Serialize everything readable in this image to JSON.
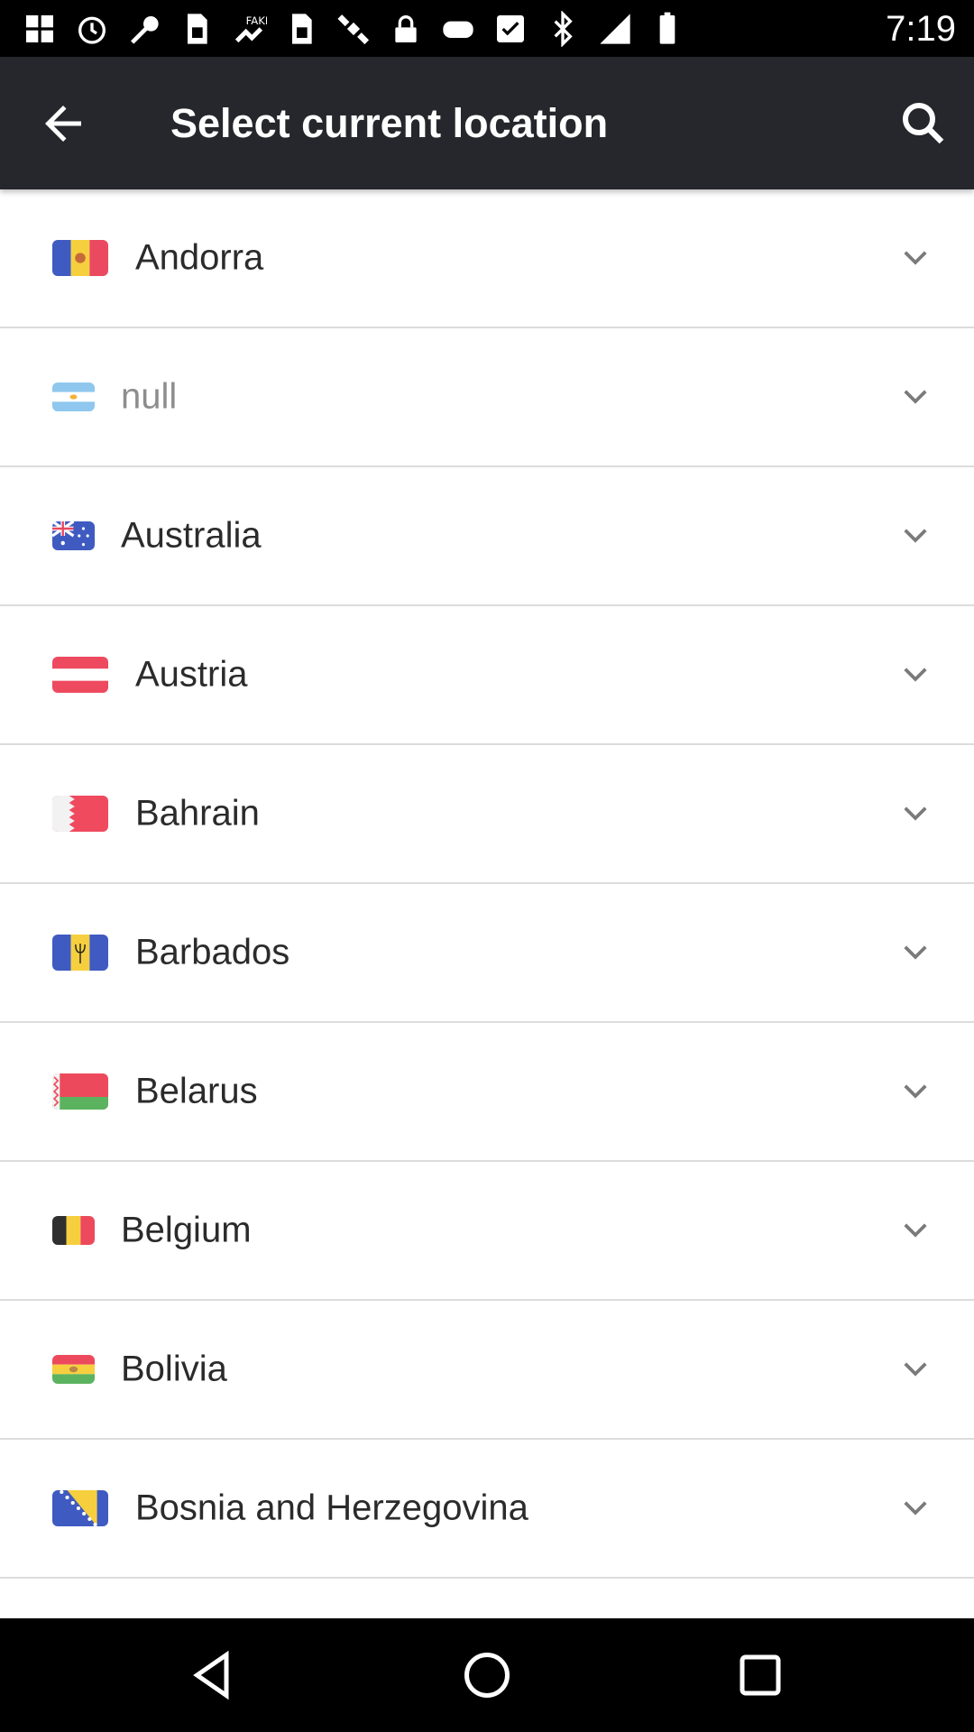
{
  "status_bar": {
    "time": "7:19",
    "icons": [
      "gallery-icon",
      "alarm-icon",
      "wrench-icon",
      "sim-icon",
      "fake-gps-icon",
      "sim-icon",
      "satellite-icon",
      "lock-icon",
      "gamepad-icon",
      "checklist-icon",
      "bluetooth-icon",
      "signal-icon",
      "battery-icon"
    ]
  },
  "header": {
    "title": "Select current location",
    "background": "#26272c"
  },
  "countries": [
    {
      "name": "Andorra",
      "flag": "andorra-flag-icon"
    },
    {
      "name": "null",
      "flag": "argentina-flag-icon"
    },
    {
      "name": "Australia",
      "flag": "australia-flag-icon"
    },
    {
      "name": "Austria",
      "flag": "austria-flag-icon"
    },
    {
      "name": "Bahrain",
      "flag": "bahrain-flag-icon"
    },
    {
      "name": "Barbados",
      "flag": "barbados-flag-icon"
    },
    {
      "name": "Belarus",
      "flag": "belarus-flag-icon"
    },
    {
      "name": "Belgium",
      "flag": "belgium-flag-icon"
    },
    {
      "name": "Bolivia",
      "flag": "bolivia-flag-icon"
    },
    {
      "name": "Bosnia and Herzegovina",
      "flag": "bosnia-flag-icon"
    }
  ],
  "nav_bar": {
    "icons": [
      "back-triangle-icon",
      "home-circle-icon",
      "recents-square-icon"
    ]
  }
}
